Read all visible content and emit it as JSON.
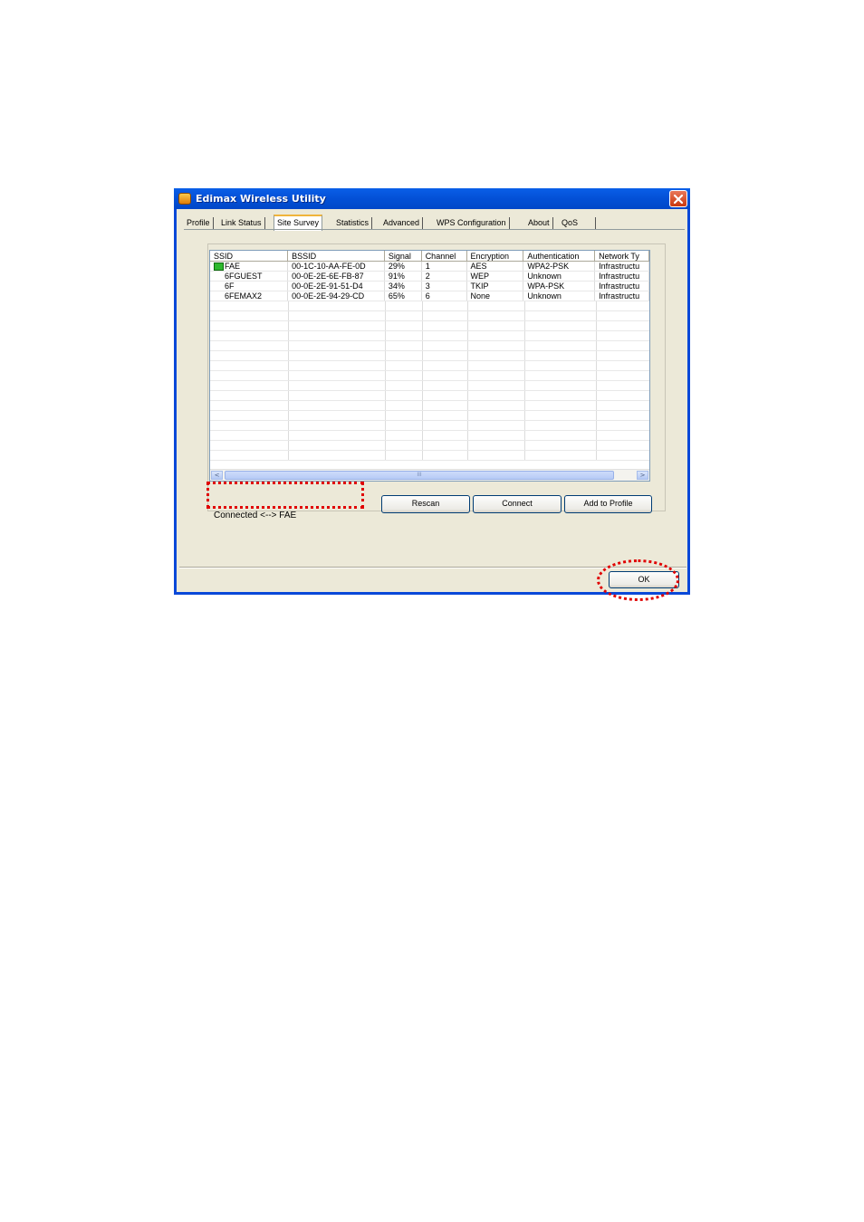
{
  "window": {
    "title": "Edimax Wireless Utility"
  },
  "tabs": [
    {
      "label": "Profile",
      "active": false
    },
    {
      "label": "Link Status",
      "active": false
    },
    {
      "label": "Site Survey",
      "active": true
    },
    {
      "label": "Statistics",
      "active": false
    },
    {
      "label": "Advanced",
      "active": false
    },
    {
      "label": "WPS Configuration",
      "active": false
    },
    {
      "label": "About",
      "active": false
    },
    {
      "label": "QoS",
      "active": false
    }
  ],
  "table": {
    "columns": [
      "SSID",
      "BSSID",
      "Signal",
      "Channel",
      "Encryption",
      "Authentication",
      "Network Ty"
    ],
    "rows": [
      {
        "ssid": "FAE",
        "bssid": "00-1C-10-AA-FE-0D",
        "signal": "29%",
        "channel": "1",
        "encryption": "AES",
        "authentication": "WPA2-PSK",
        "network_type": "Infrastructu",
        "connected": true
      },
      {
        "ssid": "6FGUEST",
        "bssid": "00-0E-2E-6E-FB-87",
        "signal": "91%",
        "channel": "2",
        "encryption": "WEP",
        "authentication": "Unknown",
        "network_type": "Infrastructu",
        "connected": false
      },
      {
        "ssid": "6F",
        "bssid": "00-0E-2E-91-51-D4",
        "signal": "34%",
        "channel": "3",
        "encryption": "TKIP",
        "authentication": "WPA-PSK",
        "network_type": "Infrastructu",
        "connected": false
      },
      {
        "ssid": "6FEMAX2",
        "bssid": "00-0E-2E-94-29-CD",
        "signal": "65%",
        "channel": "6",
        "encryption": "None",
        "authentication": "Unknown",
        "network_type": "Infrastructu",
        "connected": false
      }
    ]
  },
  "status": {
    "text": "Connected <--> FAE"
  },
  "buttons": {
    "rescan": "Rescan",
    "connect": "Connect",
    "add_to_profile": "Add to Profile",
    "ok": "OK"
  },
  "scrollbar": {
    "thumb_grip": "III"
  },
  "colors": {
    "titlebar": "#0350d6",
    "dialog_bg": "#ece9d8",
    "annotation": "#e00000"
  }
}
